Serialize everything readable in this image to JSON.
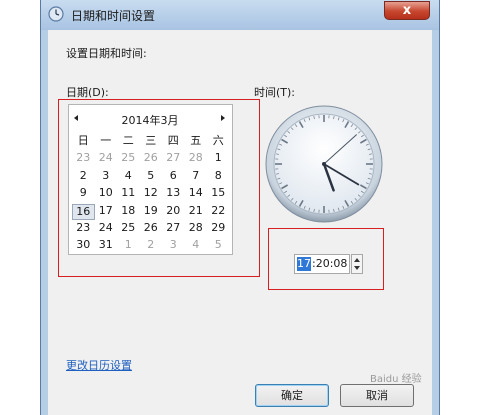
{
  "window": {
    "title": "日期和时间设置",
    "background_text": "",
    "close_label": "x"
  },
  "heading": "设置日期和时间:",
  "date_section": {
    "label": "日期(D):",
    "month_title": "2014年3月",
    "weekdays": [
      "日",
      "一",
      "二",
      "三",
      "四",
      "五",
      "六"
    ],
    "weeks": [
      [
        "23",
        "24",
        "25",
        "26",
        "27",
        "28",
        "1"
      ],
      [
        "2",
        "3",
        "4",
        "5",
        "6",
        "7",
        "8"
      ],
      [
        "9",
        "10",
        "11",
        "12",
        "13",
        "14",
        "15"
      ],
      [
        "16",
        "17",
        "18",
        "19",
        "20",
        "21",
        "22"
      ],
      [
        "23",
        "24",
        "25",
        "26",
        "27",
        "28",
        "29"
      ],
      [
        "30",
        "31",
        "1",
        "2",
        "3",
        "4",
        "5"
      ]
    ],
    "selected_day": "16"
  },
  "time_section": {
    "label": "时间(T):",
    "hour": "17",
    "rest": ":20:08",
    "clock_time": "17:20:08"
  },
  "change_calendar_link": "更改日历设置",
  "buttons": {
    "ok": "确定",
    "cancel": "取消"
  },
  "watermark": "Baidu 经验",
  "colors": {
    "annotation_red": "#d62020",
    "link_blue": "#1e60c0",
    "selection_blue": "#3078d8"
  }
}
